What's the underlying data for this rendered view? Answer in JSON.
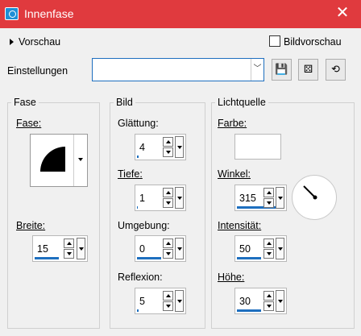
{
  "window": {
    "title": "Innenfase"
  },
  "preview": {
    "label": "Vorschau",
    "checkbox_label": "Bildvorschau"
  },
  "settings": {
    "label": "Einstellungen",
    "value": ""
  },
  "fase": {
    "title": "Fase",
    "shape_label": "Fase:",
    "width_label": "Breite:",
    "width_value": "15"
  },
  "bild": {
    "title": "Bild",
    "smoothing_label": "Glättung:",
    "smoothing_value": "4",
    "depth_label": "Tiefe:",
    "depth_value": "1",
    "ambience_label": "Umgebung:",
    "ambience_value": "0",
    "reflection_label": "Reflexion:",
    "reflection_value": "5"
  },
  "light": {
    "title": "Lichtquelle",
    "color_label": "Farbe:",
    "color": "#ffffff",
    "angle_label": "Winkel:",
    "angle_value": "315",
    "intensity_label": "Intensität:",
    "intensity_value": "50",
    "height_label": "Höhe:",
    "height_value": "30"
  },
  "colors": {
    "titlebar": "#e03a3e",
    "accent": "#1e6fbf"
  }
}
